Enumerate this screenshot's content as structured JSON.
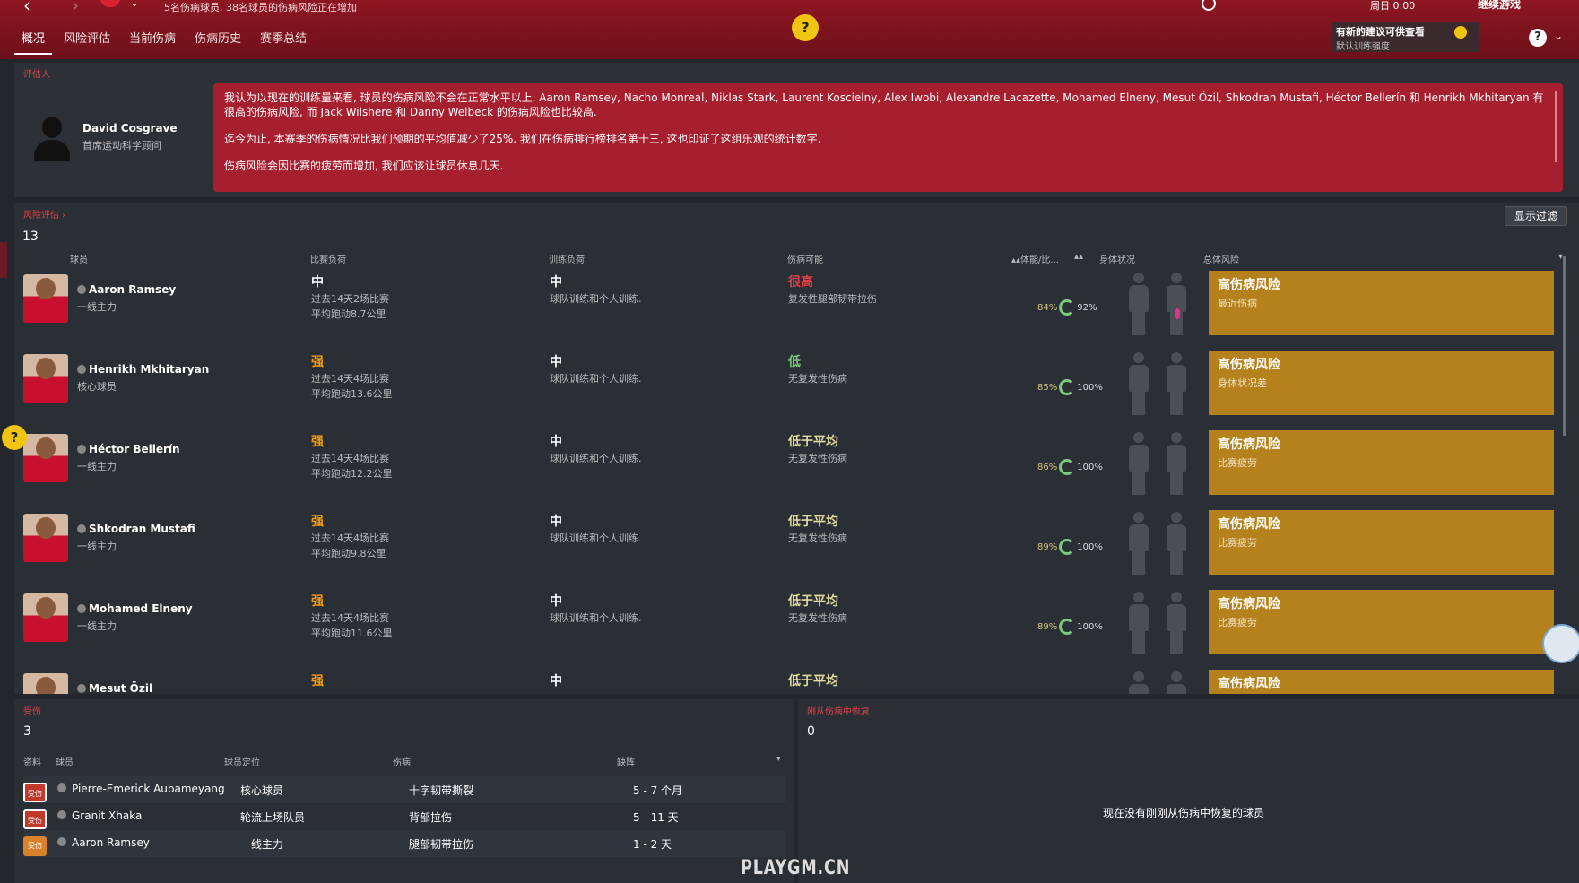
{
  "topbar": {
    "notice": "5名伤病球员, 38名球员的伤病风险正在增加",
    "tabs": [
      "概况",
      "风险评估",
      "当前伤病",
      "伤病历史",
      "赛季总结"
    ],
    "active_tab": "概况",
    "date": "周日 0:00",
    "continue_label": "继续游戏",
    "suggestion_title": "有新的建议可供查看",
    "suggestion_sub": "默认训练强度"
  },
  "help_bubble": "?",
  "assessor": {
    "section": "评估人",
    "name": "David Cosgrave",
    "role": "首席运动科学顾问",
    "paragraphs": [
      "我认为以现在的训练量来看, 球员的伤病风险不会在正常水平以上. Aaron Ramsey, Nacho Monreal, Niklas Stark, Laurent Koscielny, Alex Iwobi, Alexandre Lacazette, Mohamed Elneny, Mesut Özil, Shkodran Mustafi, Héctor Bellerín 和 Henrikh Mkhitaryan 有很高的伤病风险, 而 Jack Wilshere 和 Danny Welbeck 的伤病风险也比较高.",
      "迄今为止, 本赛季的伤病情况比我们预期的平均值减少了25%. 我们在伤病排行榜排名第十三, 这也印证了这组乐观的统计数字.",
      "伤病风险会因比赛的疲劳而增加, 我们应该让球员休息几天."
    ]
  },
  "risk": {
    "section": "风险评估 ›",
    "count": "13",
    "filter_button": "显示过滤",
    "headers": {
      "player": "球员",
      "match_load": "比赛负荷",
      "training_load": "训练负荷",
      "injury_chance": "伤病可能",
      "fitness": "▴▴体能/比...",
      "sort": "▴▴",
      "condition": "身体状况",
      "overall": "总体风险"
    },
    "rows": [
      {
        "name": "Aaron Ramsey",
        "role": "一线主力",
        "match_level": "中",
        "match_level_class": "mid",
        "match_l1": "过去14天2场比赛",
        "match_l2": "平均跑动8.7公里",
        "train_level": "中",
        "train_desc": "球队训练和个人训练.",
        "inj_level": "很高",
        "inj_class": "veryhigh",
        "inj_desc": "复发性腿部韧带拉伤",
        "pct1": "84%",
        "pct2": "92%",
        "overall": "高伤病风险",
        "overall_sub": "最近伤病",
        "hurt": true
      },
      {
        "name": "Henrikh Mkhitaryan",
        "role": "核心球员",
        "match_level": "强",
        "match_level_class": "strong",
        "match_l1": "过去14天4场比赛",
        "match_l2": "平均跑动13.6公里",
        "train_level": "中",
        "train_desc": "球队训练和个人训练.",
        "inj_level": "低",
        "inj_class": "low",
        "inj_desc": "无复发性伤病",
        "pct1": "85%",
        "pct2": "100%",
        "overall": "高伤病风险",
        "overall_sub": "身体状况差",
        "hurt": false
      },
      {
        "name": "Héctor Bellerín",
        "role": "一线主力",
        "match_level": "强",
        "match_level_class": "strong",
        "match_l1": "过去14天4场比赛",
        "match_l2": "平均跑动12.2公里",
        "train_level": "中",
        "train_desc": "球队训练和个人训练.",
        "inj_level": "低于平均",
        "inj_class": "below",
        "inj_desc": "无复发性伤病",
        "pct1": "86%",
        "pct2": "100%",
        "overall": "高伤病风险",
        "overall_sub": "比赛疲劳",
        "hurt": false
      },
      {
        "name": "Shkodran Mustafi",
        "role": "一线主力",
        "match_level": "强",
        "match_level_class": "strong",
        "match_l1": "过去14天4场比赛",
        "match_l2": "平均跑动9.8公里",
        "train_level": "中",
        "train_desc": "球队训练和个人训练.",
        "inj_level": "低于平均",
        "inj_class": "below",
        "inj_desc": "无复发性伤病",
        "pct1": "89%",
        "pct2": "100%",
        "overall": "高伤病风险",
        "overall_sub": "比赛疲劳",
        "hurt": false
      },
      {
        "name": "Mohamed Elneny",
        "role": "一线主力",
        "match_level": "强",
        "match_level_class": "strong",
        "match_l1": "过去14天4场比赛",
        "match_l2": "平均跑动11.6公里",
        "train_level": "中",
        "train_desc": "球队训练和个人训练.",
        "inj_level": "低于平均",
        "inj_class": "below",
        "inj_desc": "无复发性伤病",
        "pct1": "89%",
        "pct2": "100%",
        "overall": "高伤病风险",
        "overall_sub": "比赛疲劳",
        "hurt": false
      },
      {
        "name": "Mesut Özil",
        "role": "",
        "match_level": "强",
        "match_level_class": "strong",
        "match_l1": "",
        "match_l2": "",
        "train_level": "中",
        "train_desc": "",
        "inj_level": "低于平均",
        "inj_class": "below",
        "inj_desc": "",
        "pct1": "",
        "pct2": "",
        "overall": "高伤病风险",
        "overall_sub": "",
        "hurt": false
      }
    ]
  },
  "injured": {
    "section": "受伤",
    "count": "3",
    "headers": {
      "info": "资料",
      "player": "球员",
      "position": "球员定位",
      "injury": "伤病",
      "absence": "缺阵"
    },
    "rows": [
      {
        "badge": "受伤",
        "badge_class": "red",
        "name": "Pierre-Emerick Aubameyang",
        "position": "核心球员",
        "injury": "十字韧带撕裂",
        "absence": "5 - 7 个月"
      },
      {
        "badge": "受伤",
        "badge_class": "red",
        "name": "Granit Xhaka",
        "position": "轮流上场队员",
        "injury": "背部拉伤",
        "absence": "5 - 11 天"
      },
      {
        "badge": "受伤",
        "badge_class": "orange",
        "name": "Aaron Ramsey",
        "position": "一线主力",
        "injury": "腿部韧带拉伤",
        "absence": "1 - 2 天"
      }
    ]
  },
  "recovered": {
    "section": "刚从伤病中恢复",
    "count": "0",
    "empty": "现在没有刚刚从伤病中恢复的球员"
  },
  "watermark": "PLAYGM.CN",
  "colors": {
    "accent_red": "#a51f2e",
    "risk_box": "#b5811d",
    "bg": "#23272c"
  },
  "icons": [
    "back-arrow-icon",
    "forward-arrow-icon",
    "club-crest-icon",
    "search-icon",
    "help-icon",
    "info-icon",
    "chatbot-icon"
  ]
}
